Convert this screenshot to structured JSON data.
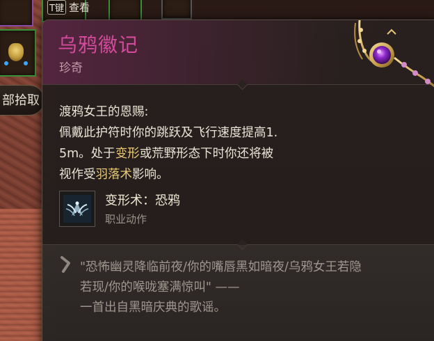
{
  "background": {
    "hint_key": "T键",
    "hint_label": "查看",
    "pickup_label": "部拾取"
  },
  "tooltip": {
    "item_name": "乌鸦徽记",
    "rarity": "珍奇",
    "description": {
      "title": "渡鸦女王的恩赐:",
      "line1": "佩戴此护符时你的跳跃及飞行速度提高1.",
      "line2_prefix": "5m。处于",
      "line2_hl1": "变形",
      "line2_mid": "或荒野形态下时你还将被",
      "line3_prefix": "视作受",
      "line3_hl": "羽落术",
      "line3_suffix": "影响。"
    },
    "spell": {
      "icon": "raven-wing-icon",
      "name": "变形术：恐鸦",
      "type": "职业动作"
    },
    "lore": {
      "line1": "\"恐怖幽灵降临前夜/你的嘴唇黑如暗夜/乌鸦女王若隐",
      "line2": "若现/你的喉咙塞满惊叫\" ——",
      "line3": "一首出自黑暗庆典的歌谣。"
    },
    "colors": {
      "item_name": "#d44a9c",
      "highlight": "#e7c877",
      "lore_text": "#9f978f"
    }
  }
}
